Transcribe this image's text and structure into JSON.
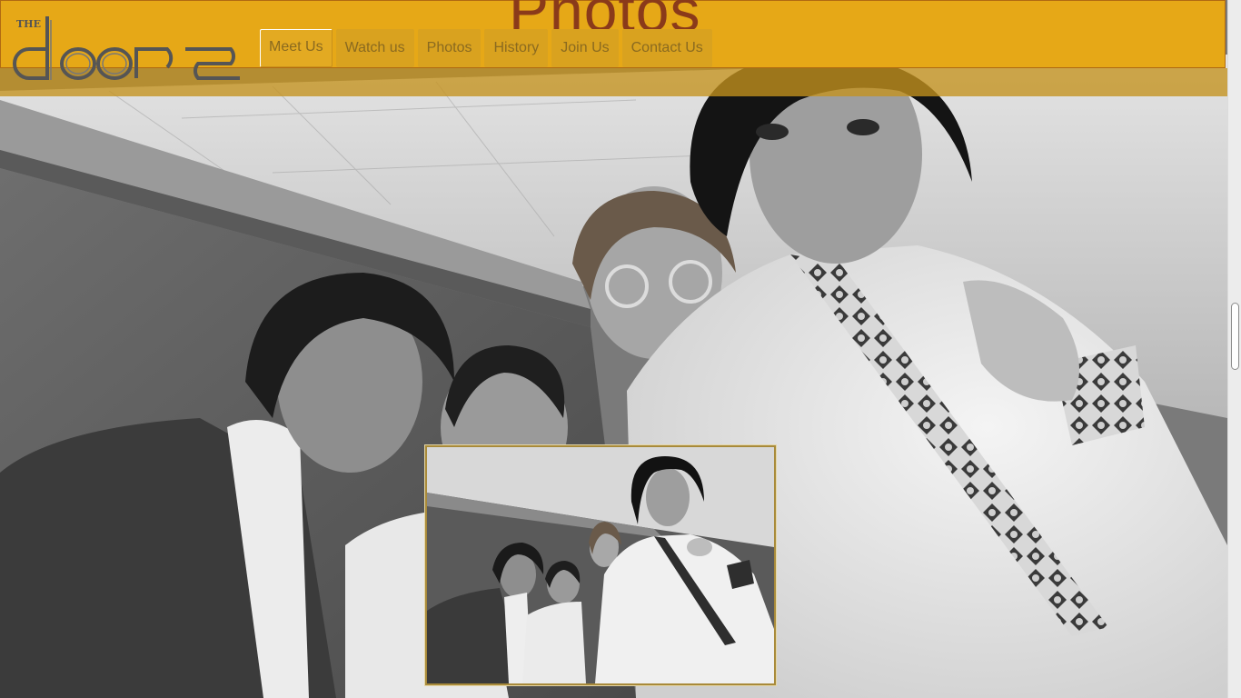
{
  "header": {
    "page_title": "Photos",
    "logo": {
      "small_text": "THE",
      "wordmark": "doors"
    }
  },
  "nav": {
    "items": [
      {
        "label": "Meet Us",
        "active": true
      },
      {
        "label": "Watch us",
        "active": false
      },
      {
        "label": "Photos",
        "active": false
      },
      {
        "label": "History",
        "active": false
      },
      {
        "label": "Join Us",
        "active": false
      },
      {
        "label": "Contact Us",
        "active": false
      }
    ]
  },
  "colors": {
    "header_bg": "#e6a817",
    "header_border": "#b06a12",
    "title_color": "#8a3a1a",
    "nav_text": "#8a6a20"
  },
  "icons": {
    "logo": "the-doors-logo"
  }
}
